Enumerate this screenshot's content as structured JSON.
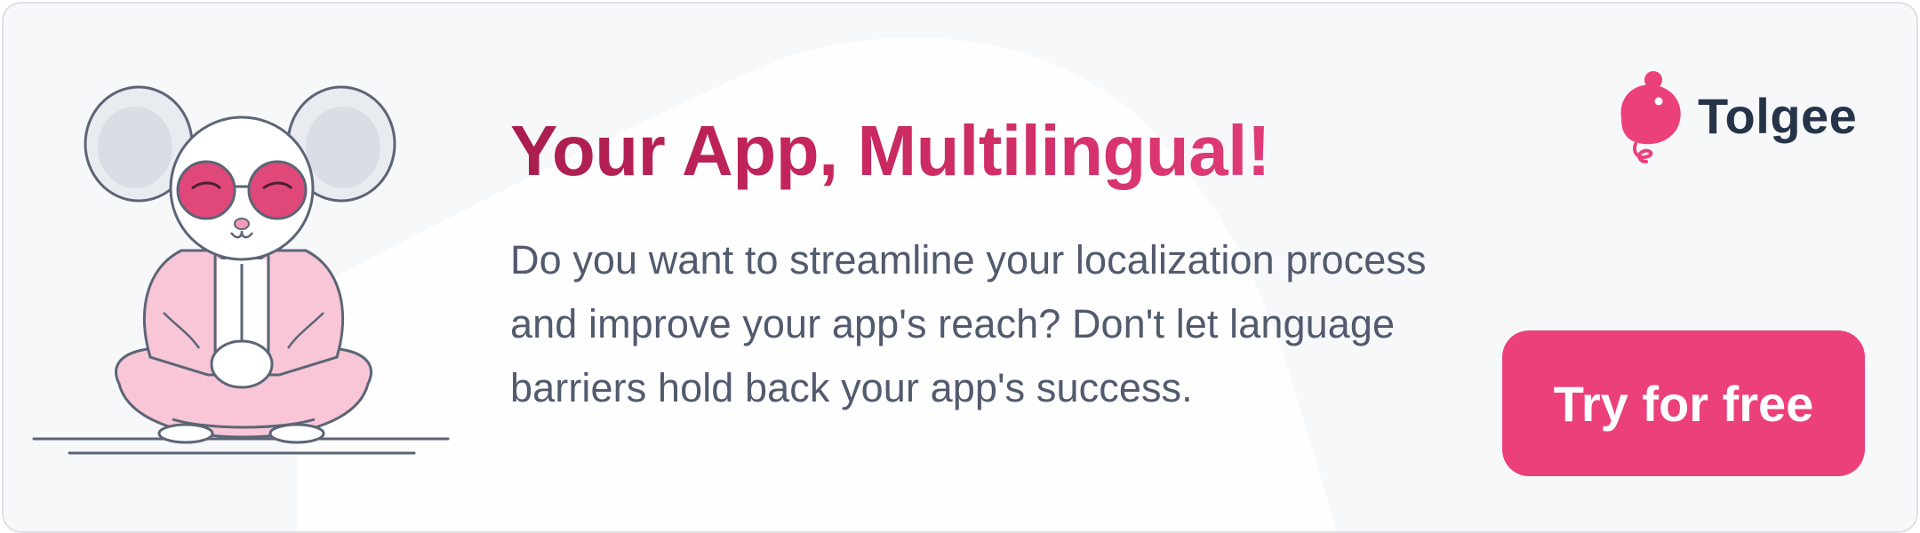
{
  "banner": {
    "headline": "Your App, Multilingual!",
    "body": "Do you want to streamline your localization process and improve your app's reach? Don't let language barriers hold back your app's success.",
    "cta_label": "Try for free",
    "brand": {
      "name": "Tolgee",
      "logo_icon": "tolgee-mouse-logo-icon"
    },
    "illustration_icon": "meditating-mouse-illustration",
    "colors": {
      "accent": "#ec407a",
      "headline_start": "#a91d4f",
      "headline_end": "#e03b78",
      "body_text": "#525a6e",
      "brand_text": "#26344a",
      "background": "#f7f8fa"
    }
  }
}
